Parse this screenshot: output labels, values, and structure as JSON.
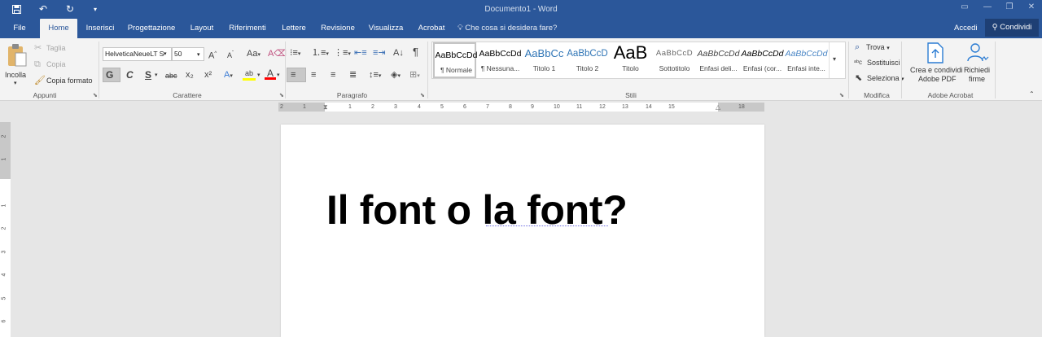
{
  "window": {
    "title": "Documento1 - Word"
  },
  "tabs": [
    "File",
    "Home",
    "Inserisci",
    "Progettazione",
    "Layout",
    "Riferimenti",
    "Lettere",
    "Revisione",
    "Visualizza",
    "Acrobat"
  ],
  "tell_me": "Che cosa si desidera fare?",
  "account": {
    "accedi": "Accedi",
    "condividi": "Condividi"
  },
  "clipboard": {
    "paste": "Incolla",
    "cut": "Taglia",
    "copy": "Copia",
    "format_painter": "Copia formato",
    "group": "Appunti"
  },
  "font": {
    "name": "HelveticaNeueLT Std",
    "size": "50",
    "bold": "G",
    "italic": "C",
    "underline": "S",
    "strike": "abc",
    "sub": "x₂",
    "sup": "x²",
    "group": "Carattere"
  },
  "paragraph": {
    "group": "Paragrafo"
  },
  "styles": {
    "group": "Stili",
    "items": [
      {
        "sample": "AaBbCcDd",
        "name": "¶ Normale"
      },
      {
        "sample": "AaBbCcDd",
        "name": "¶ Nessuna..."
      },
      {
        "sample": "AaBbCc",
        "name": "Titolo 1"
      },
      {
        "sample": "AaBbCcD",
        "name": "Titolo 2"
      },
      {
        "sample": "AaB",
        "name": "Titolo"
      },
      {
        "sample": "AaBbCcD",
        "name": "Sottotitolo"
      },
      {
        "sample": "AaBbCcDd",
        "name": "Enfasi deli..."
      },
      {
        "sample": "AaBbCcDd",
        "name": "Enfasi (cor..."
      },
      {
        "sample": "AaBbCcDd",
        "name": "Enfasi inte..."
      }
    ]
  },
  "editing": {
    "find": "Trova",
    "replace": "Sostituisci",
    "select": "Seleziona",
    "group": "Modifica"
  },
  "acrobat": {
    "create": "Crea e condividi",
    "create2": "Adobe PDF",
    "sign": "Richiedi",
    "sign2": "firme",
    "group": "Adobe Acrobat"
  },
  "ruler_h": [
    "2",
    "1",
    "1",
    "2",
    "3",
    "4",
    "5",
    "6",
    "7",
    "8",
    "9",
    "10",
    "11",
    "12",
    "13",
    "14",
    "15",
    "16",
    "18"
  ],
  "ruler_v": [
    "2",
    "1",
    "1",
    "2",
    "3",
    "4",
    "5",
    "6"
  ],
  "document": {
    "text": "Il font o la font?"
  },
  "colors": {
    "accent": "#2b579a",
    "highlight": "#ffff00",
    "font_color": "#ff0000"
  }
}
